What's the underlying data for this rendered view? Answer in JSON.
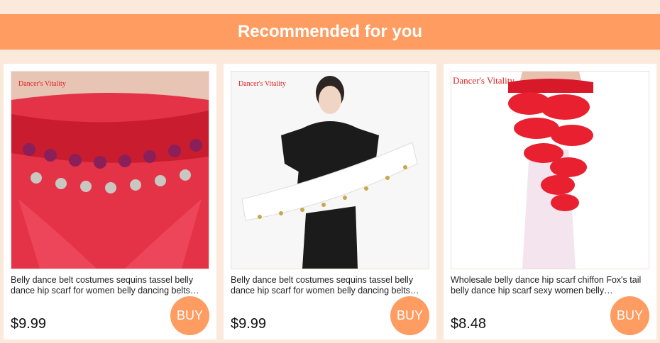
{
  "header": {
    "title": "Recommended for you"
  },
  "products": [
    {
      "brand": "Dancer's Vitality",
      "title": "Belly dance belt costumes sequins tassel belly dance hip scarf for women belly dancing belts…",
      "price": "$9.99",
      "buy_label": "BUY"
    },
    {
      "brand": "Dancer's Vitality",
      "title": "Belly dance belt costumes sequins tassel belly dance hip scarf for women belly dancing belts…",
      "price": "$9.99",
      "buy_label": "BUY"
    },
    {
      "brand": "Dancer's Vitality",
      "title": "Wholesale belly dance hip scarf chiffon Fox's tail belly dance hip scarf sexy women belly…",
      "price": "$8.48",
      "buy_label": "BUY"
    }
  ],
  "colors": {
    "accent": "#fe9c61",
    "background": "#fbe9dc",
    "brand_text": "#e02020"
  }
}
